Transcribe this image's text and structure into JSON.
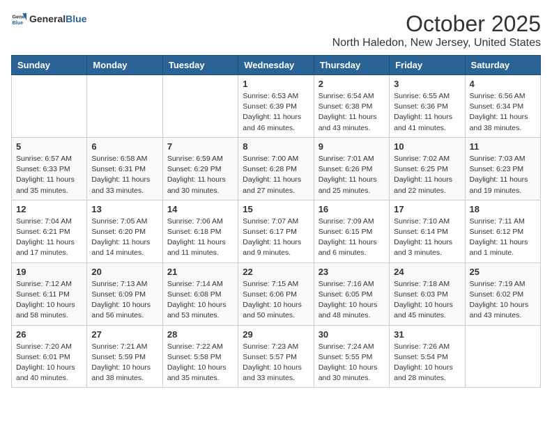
{
  "header": {
    "logo_general": "General",
    "logo_blue": "Blue",
    "month_title": "October 2025",
    "location": "North Haledon, New Jersey, United States"
  },
  "days_of_week": [
    "Sunday",
    "Monday",
    "Tuesday",
    "Wednesday",
    "Thursday",
    "Friday",
    "Saturday"
  ],
  "weeks": [
    [
      {
        "day": "",
        "info": ""
      },
      {
        "day": "",
        "info": ""
      },
      {
        "day": "",
        "info": ""
      },
      {
        "day": "1",
        "info": "Sunrise: 6:53 AM\nSunset: 6:39 PM\nDaylight: 11 hours\nand 46 minutes."
      },
      {
        "day": "2",
        "info": "Sunrise: 6:54 AM\nSunset: 6:38 PM\nDaylight: 11 hours\nand 43 minutes."
      },
      {
        "day": "3",
        "info": "Sunrise: 6:55 AM\nSunset: 6:36 PM\nDaylight: 11 hours\nand 41 minutes."
      },
      {
        "day": "4",
        "info": "Sunrise: 6:56 AM\nSunset: 6:34 PM\nDaylight: 11 hours\nand 38 minutes."
      }
    ],
    [
      {
        "day": "5",
        "info": "Sunrise: 6:57 AM\nSunset: 6:33 PM\nDaylight: 11 hours\nand 35 minutes."
      },
      {
        "day": "6",
        "info": "Sunrise: 6:58 AM\nSunset: 6:31 PM\nDaylight: 11 hours\nand 33 minutes."
      },
      {
        "day": "7",
        "info": "Sunrise: 6:59 AM\nSunset: 6:29 PM\nDaylight: 11 hours\nand 30 minutes."
      },
      {
        "day": "8",
        "info": "Sunrise: 7:00 AM\nSunset: 6:28 PM\nDaylight: 11 hours\nand 27 minutes."
      },
      {
        "day": "9",
        "info": "Sunrise: 7:01 AM\nSunset: 6:26 PM\nDaylight: 11 hours\nand 25 minutes."
      },
      {
        "day": "10",
        "info": "Sunrise: 7:02 AM\nSunset: 6:25 PM\nDaylight: 11 hours\nand 22 minutes."
      },
      {
        "day": "11",
        "info": "Sunrise: 7:03 AM\nSunset: 6:23 PM\nDaylight: 11 hours\nand 19 minutes."
      }
    ],
    [
      {
        "day": "12",
        "info": "Sunrise: 7:04 AM\nSunset: 6:21 PM\nDaylight: 11 hours\nand 17 minutes."
      },
      {
        "day": "13",
        "info": "Sunrise: 7:05 AM\nSunset: 6:20 PM\nDaylight: 11 hours\nand 14 minutes."
      },
      {
        "day": "14",
        "info": "Sunrise: 7:06 AM\nSunset: 6:18 PM\nDaylight: 11 hours\nand 11 minutes."
      },
      {
        "day": "15",
        "info": "Sunrise: 7:07 AM\nSunset: 6:17 PM\nDaylight: 11 hours\nand 9 minutes."
      },
      {
        "day": "16",
        "info": "Sunrise: 7:09 AM\nSunset: 6:15 PM\nDaylight: 11 hours\nand 6 minutes."
      },
      {
        "day": "17",
        "info": "Sunrise: 7:10 AM\nSunset: 6:14 PM\nDaylight: 11 hours\nand 3 minutes."
      },
      {
        "day": "18",
        "info": "Sunrise: 7:11 AM\nSunset: 6:12 PM\nDaylight: 11 hours\nand 1 minute."
      }
    ],
    [
      {
        "day": "19",
        "info": "Sunrise: 7:12 AM\nSunset: 6:11 PM\nDaylight: 10 hours\nand 58 minutes."
      },
      {
        "day": "20",
        "info": "Sunrise: 7:13 AM\nSunset: 6:09 PM\nDaylight: 10 hours\nand 56 minutes."
      },
      {
        "day": "21",
        "info": "Sunrise: 7:14 AM\nSunset: 6:08 PM\nDaylight: 10 hours\nand 53 minutes."
      },
      {
        "day": "22",
        "info": "Sunrise: 7:15 AM\nSunset: 6:06 PM\nDaylight: 10 hours\nand 50 minutes."
      },
      {
        "day": "23",
        "info": "Sunrise: 7:16 AM\nSunset: 6:05 PM\nDaylight: 10 hours\nand 48 minutes."
      },
      {
        "day": "24",
        "info": "Sunrise: 7:18 AM\nSunset: 6:03 PM\nDaylight: 10 hours\nand 45 minutes."
      },
      {
        "day": "25",
        "info": "Sunrise: 7:19 AM\nSunset: 6:02 PM\nDaylight: 10 hours\nand 43 minutes."
      }
    ],
    [
      {
        "day": "26",
        "info": "Sunrise: 7:20 AM\nSunset: 6:01 PM\nDaylight: 10 hours\nand 40 minutes."
      },
      {
        "day": "27",
        "info": "Sunrise: 7:21 AM\nSunset: 5:59 PM\nDaylight: 10 hours\nand 38 minutes."
      },
      {
        "day": "28",
        "info": "Sunrise: 7:22 AM\nSunset: 5:58 PM\nDaylight: 10 hours\nand 35 minutes."
      },
      {
        "day": "29",
        "info": "Sunrise: 7:23 AM\nSunset: 5:57 PM\nDaylight: 10 hours\nand 33 minutes."
      },
      {
        "day": "30",
        "info": "Sunrise: 7:24 AM\nSunset: 5:55 PM\nDaylight: 10 hours\nand 30 minutes."
      },
      {
        "day": "31",
        "info": "Sunrise: 7:26 AM\nSunset: 5:54 PM\nDaylight: 10 hours\nand 28 minutes."
      },
      {
        "day": "",
        "info": ""
      }
    ]
  ]
}
